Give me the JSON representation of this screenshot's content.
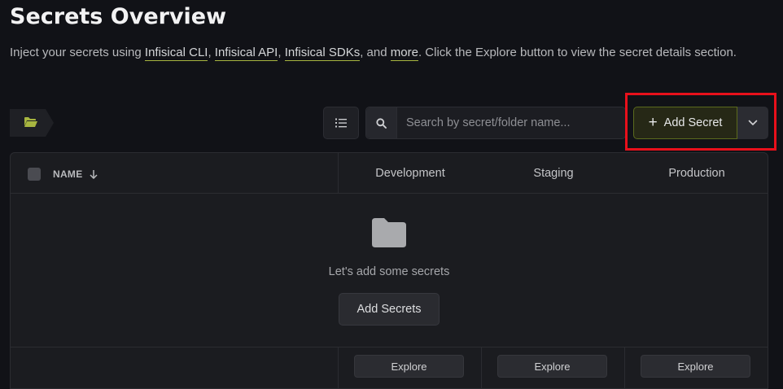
{
  "header": {
    "title": "Secrets Overview",
    "subtitle_prefix": "Inject your secrets using ",
    "links": [
      "Infisical CLI",
      "Infisical API",
      "Infisical SDKs",
      "more"
    ],
    "sep1": ", ",
    "sep2": ", ",
    "sep3": ", and ",
    "subtitle_suffix": ". Click the Explore button to view the secret details section."
  },
  "toolbar": {
    "search_placeholder": "Search by secret/folder name...",
    "add_secret_label": "Add Secret",
    "plus": "+"
  },
  "table": {
    "name_header": "NAME",
    "environments": [
      "Development",
      "Staging",
      "Production"
    ],
    "empty_text": "Let's add some secrets",
    "add_secrets_label": "Add Secrets",
    "explore_label": "Explore"
  },
  "colors": {
    "accent": "#a7b540",
    "folder_icon": "#a7b540",
    "highlight_border": "#e8101b"
  },
  "icons": [
    "folder-open-icon",
    "list-icon",
    "search-icon",
    "chevron-down-icon",
    "arrow-down-icon",
    "folder-icon"
  ]
}
